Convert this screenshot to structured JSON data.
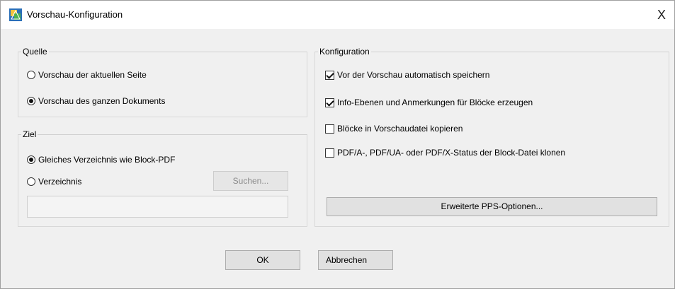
{
  "window": {
    "title": "Vorschau-Konfiguration",
    "close_glyph": "X"
  },
  "quelle": {
    "legend": "Quelle",
    "options": [
      {
        "label": "Vorschau der aktuellen Seite",
        "selected": false
      },
      {
        "label": "Vorschau des ganzen Dokuments",
        "selected": true
      }
    ]
  },
  "ziel": {
    "legend": "Ziel",
    "options": [
      {
        "label": "Gleiches Verzeichnis wie Block-PDF",
        "selected": true
      },
      {
        "label": "Verzeichnis",
        "selected": false
      }
    ],
    "search_label": "Suchen...",
    "path_value": ""
  },
  "konfiguration": {
    "legend": "Konfiguration",
    "checks": [
      {
        "label": "Vor der Vorschau automatisch speichern",
        "checked": true
      },
      {
        "label": "Info-Ebenen und Anmerkungen für Blöcke erzeugen",
        "checked": true
      },
      {
        "label": "Blöcke in Vorschaudatei kopieren",
        "checked": false
      },
      {
        "label": "PDF/A-, PDF/UA- oder PDF/X-Status der Block-Datei klonen",
        "checked": false
      }
    ],
    "advanced_label": "Erweiterte PPS-Optionen..."
  },
  "footer": {
    "ok_label": "OK",
    "cancel_label": "Abbrechen"
  }
}
